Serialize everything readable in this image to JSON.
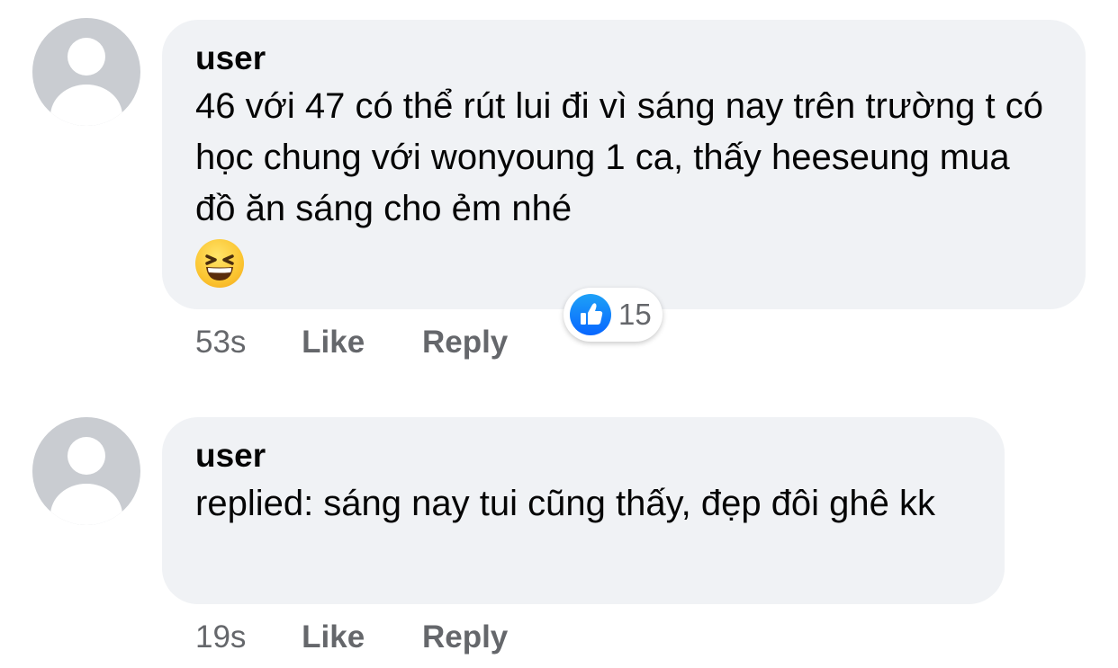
{
  "comments": [
    {
      "author": "user",
      "text": "46 với 47 có thể rút lui đi vì sáng nay trên trường t có học chung với wonyoung 1 ca, thấy heeseung mua đồ ăn sáng cho ẻm nhé",
      "emoji": "grinning-squinting-face",
      "time": "53s",
      "like_label": "Like",
      "reply_label": "Reply",
      "reaction_count": "15"
    },
    {
      "author": "user",
      "text": "replied: sáng nay tui cũng thấy, đẹp đôi ghê kk",
      "time": "19s",
      "like_label": "Like",
      "reply_label": "Reply"
    }
  ],
  "colors": {
    "bubble": "#f0f2f5",
    "meta_text": "#65676b",
    "like_blue": "#0866ff",
    "avatar_gray": "#c9ccd1"
  }
}
